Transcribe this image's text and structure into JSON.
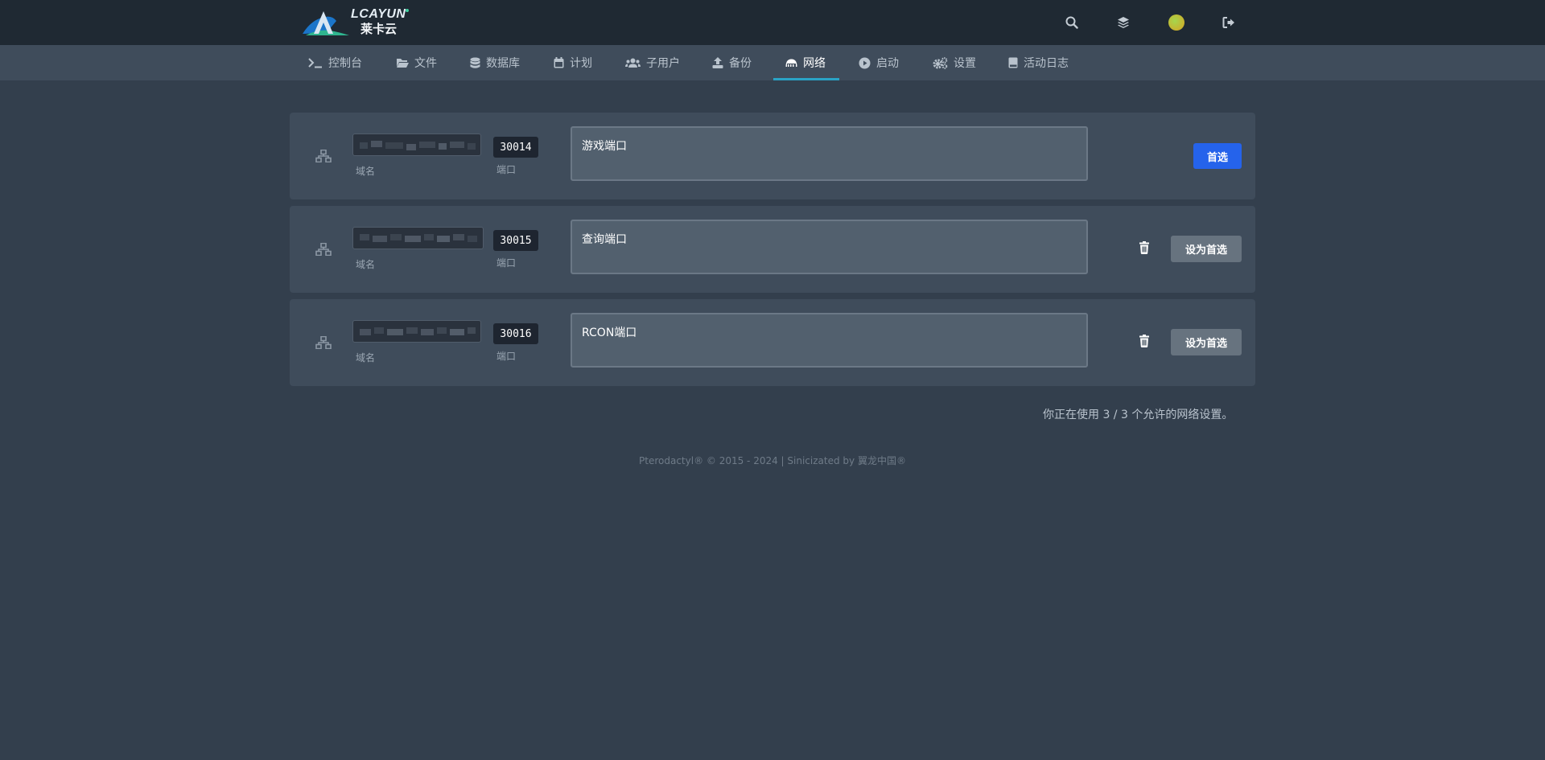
{
  "brand": {
    "logo_text": "LCAYUN",
    "logo_sub": "莱卡云"
  },
  "top_icons": [
    "search-icon",
    "layers-icon",
    "avatar",
    "logout-icon"
  ],
  "nav": {
    "items": [
      {
        "label": "控制台",
        "icon": "terminal-icon"
      },
      {
        "label": "文件",
        "icon": "folder-icon"
      },
      {
        "label": "数据库",
        "icon": "database-icon"
      },
      {
        "label": "计划",
        "icon": "calendar-icon"
      },
      {
        "label": "子用户",
        "icon": "users-icon"
      },
      {
        "label": "备份",
        "icon": "upload-icon"
      },
      {
        "label": "网络",
        "icon": "network-icon",
        "active": true
      },
      {
        "label": "启动",
        "icon": "play-icon"
      },
      {
        "label": "设置",
        "icon": "cogs-icon"
      },
      {
        "label": "活动日志",
        "icon": "book-icon"
      }
    ]
  },
  "allocations": [
    {
      "hostname_label": "域名",
      "port": "30014",
      "port_label": "端口",
      "notes": "游戏端口",
      "primary": true,
      "button_label": "首选"
    },
    {
      "hostname_label": "域名",
      "port": "30015",
      "port_label": "端口",
      "notes": "查询端口",
      "primary": false,
      "button_label": "设为首选"
    },
    {
      "hostname_label": "域名",
      "port": "30016",
      "port_label": "端口",
      "notes": "RCON端口",
      "primary": false,
      "button_label": "设为首选"
    }
  ],
  "usage_text": "你正在使用 3 / 3 个允许的网络设置。",
  "footer": "Pterodactyl® © 2015 - 2024 | Sinicizated by 翼龙中国®",
  "colors": {
    "accent": "#2aa3c5",
    "primary_button": "#2563eb",
    "background": "#333f4d"
  }
}
